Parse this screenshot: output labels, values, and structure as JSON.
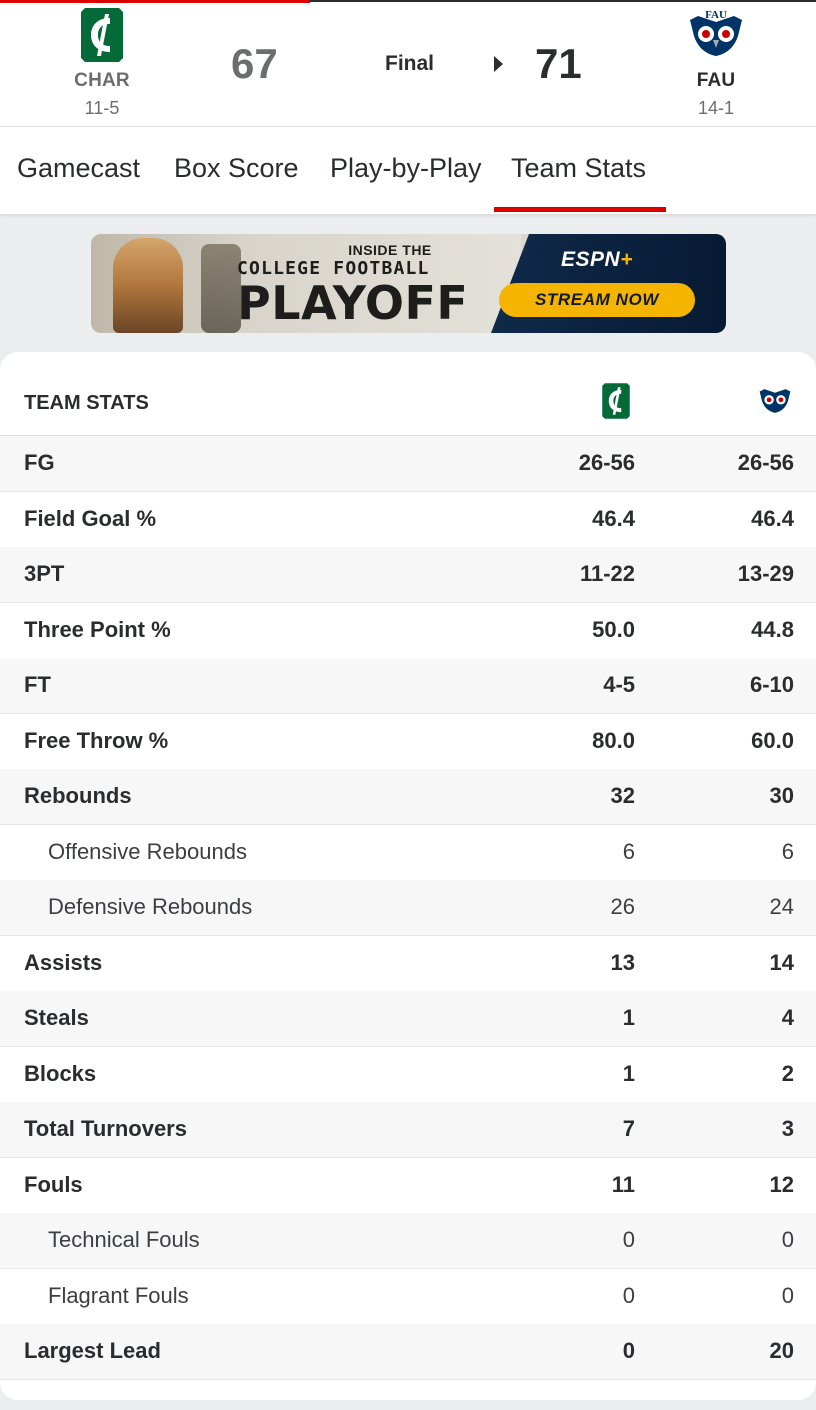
{
  "game": {
    "status": "Final",
    "away": {
      "abbr": "CHAR",
      "record": "11-5",
      "score": "67",
      "color": "#046a38"
    },
    "home": {
      "abbr": "FAU",
      "record": "14-1",
      "score": "71",
      "color": "#003366",
      "logo_text": "FAU"
    }
  },
  "tabs": [
    {
      "label": "Gamecast",
      "active": false
    },
    {
      "label": "Box Score",
      "active": false
    },
    {
      "label": "Play-by-Play",
      "active": false
    },
    {
      "label": "Team Stats",
      "active": true
    }
  ],
  "ad": {
    "line1": "INSIDE THE",
    "line2": "COLLEGE FOOTBALL",
    "line3": "PLAYOFF",
    "brand": "ESPN",
    "brand_plus": "+",
    "cta": "STREAM NOW"
  },
  "stats": {
    "title": "TEAM STATS",
    "rows": [
      {
        "label": "FG",
        "away": "26-56",
        "home": "26-56",
        "kind": "main"
      },
      {
        "label": "Field Goal %",
        "away": "46.4",
        "home": "46.4",
        "kind": "main"
      },
      {
        "label": "3PT",
        "away": "11-22",
        "home": "13-29",
        "kind": "main"
      },
      {
        "label": "Three Point %",
        "away": "50.0",
        "home": "44.8",
        "kind": "main"
      },
      {
        "label": "FT",
        "away": "4-5",
        "home": "6-10",
        "kind": "main"
      },
      {
        "label": "Free Throw %",
        "away": "80.0",
        "home": "60.0",
        "kind": "main"
      },
      {
        "label": "Rebounds",
        "away": "32",
        "home": "30",
        "kind": "main"
      },
      {
        "label": "Offensive Rebounds",
        "away": "6",
        "home": "6",
        "kind": "sub"
      },
      {
        "label": "Defensive Rebounds",
        "away": "26",
        "home": "24",
        "kind": "sub"
      },
      {
        "label": "Assists",
        "away": "13",
        "home": "14",
        "kind": "main"
      },
      {
        "label": "Steals",
        "away": "1",
        "home": "4",
        "kind": "main"
      },
      {
        "label": "Blocks",
        "away": "1",
        "home": "2",
        "kind": "main"
      },
      {
        "label": "Total Turnovers",
        "away": "7",
        "home": "3",
        "kind": "main"
      },
      {
        "label": "Fouls",
        "away": "11",
        "home": "12",
        "kind": "main"
      },
      {
        "label": "Technical Fouls",
        "away": "0",
        "home": "0",
        "kind": "sub"
      },
      {
        "label": "Flagrant Fouls",
        "away": "0",
        "home": "0",
        "kind": "sub"
      },
      {
        "label": "Largest Lead",
        "away": "0",
        "home": "20",
        "kind": "main"
      }
    ]
  }
}
